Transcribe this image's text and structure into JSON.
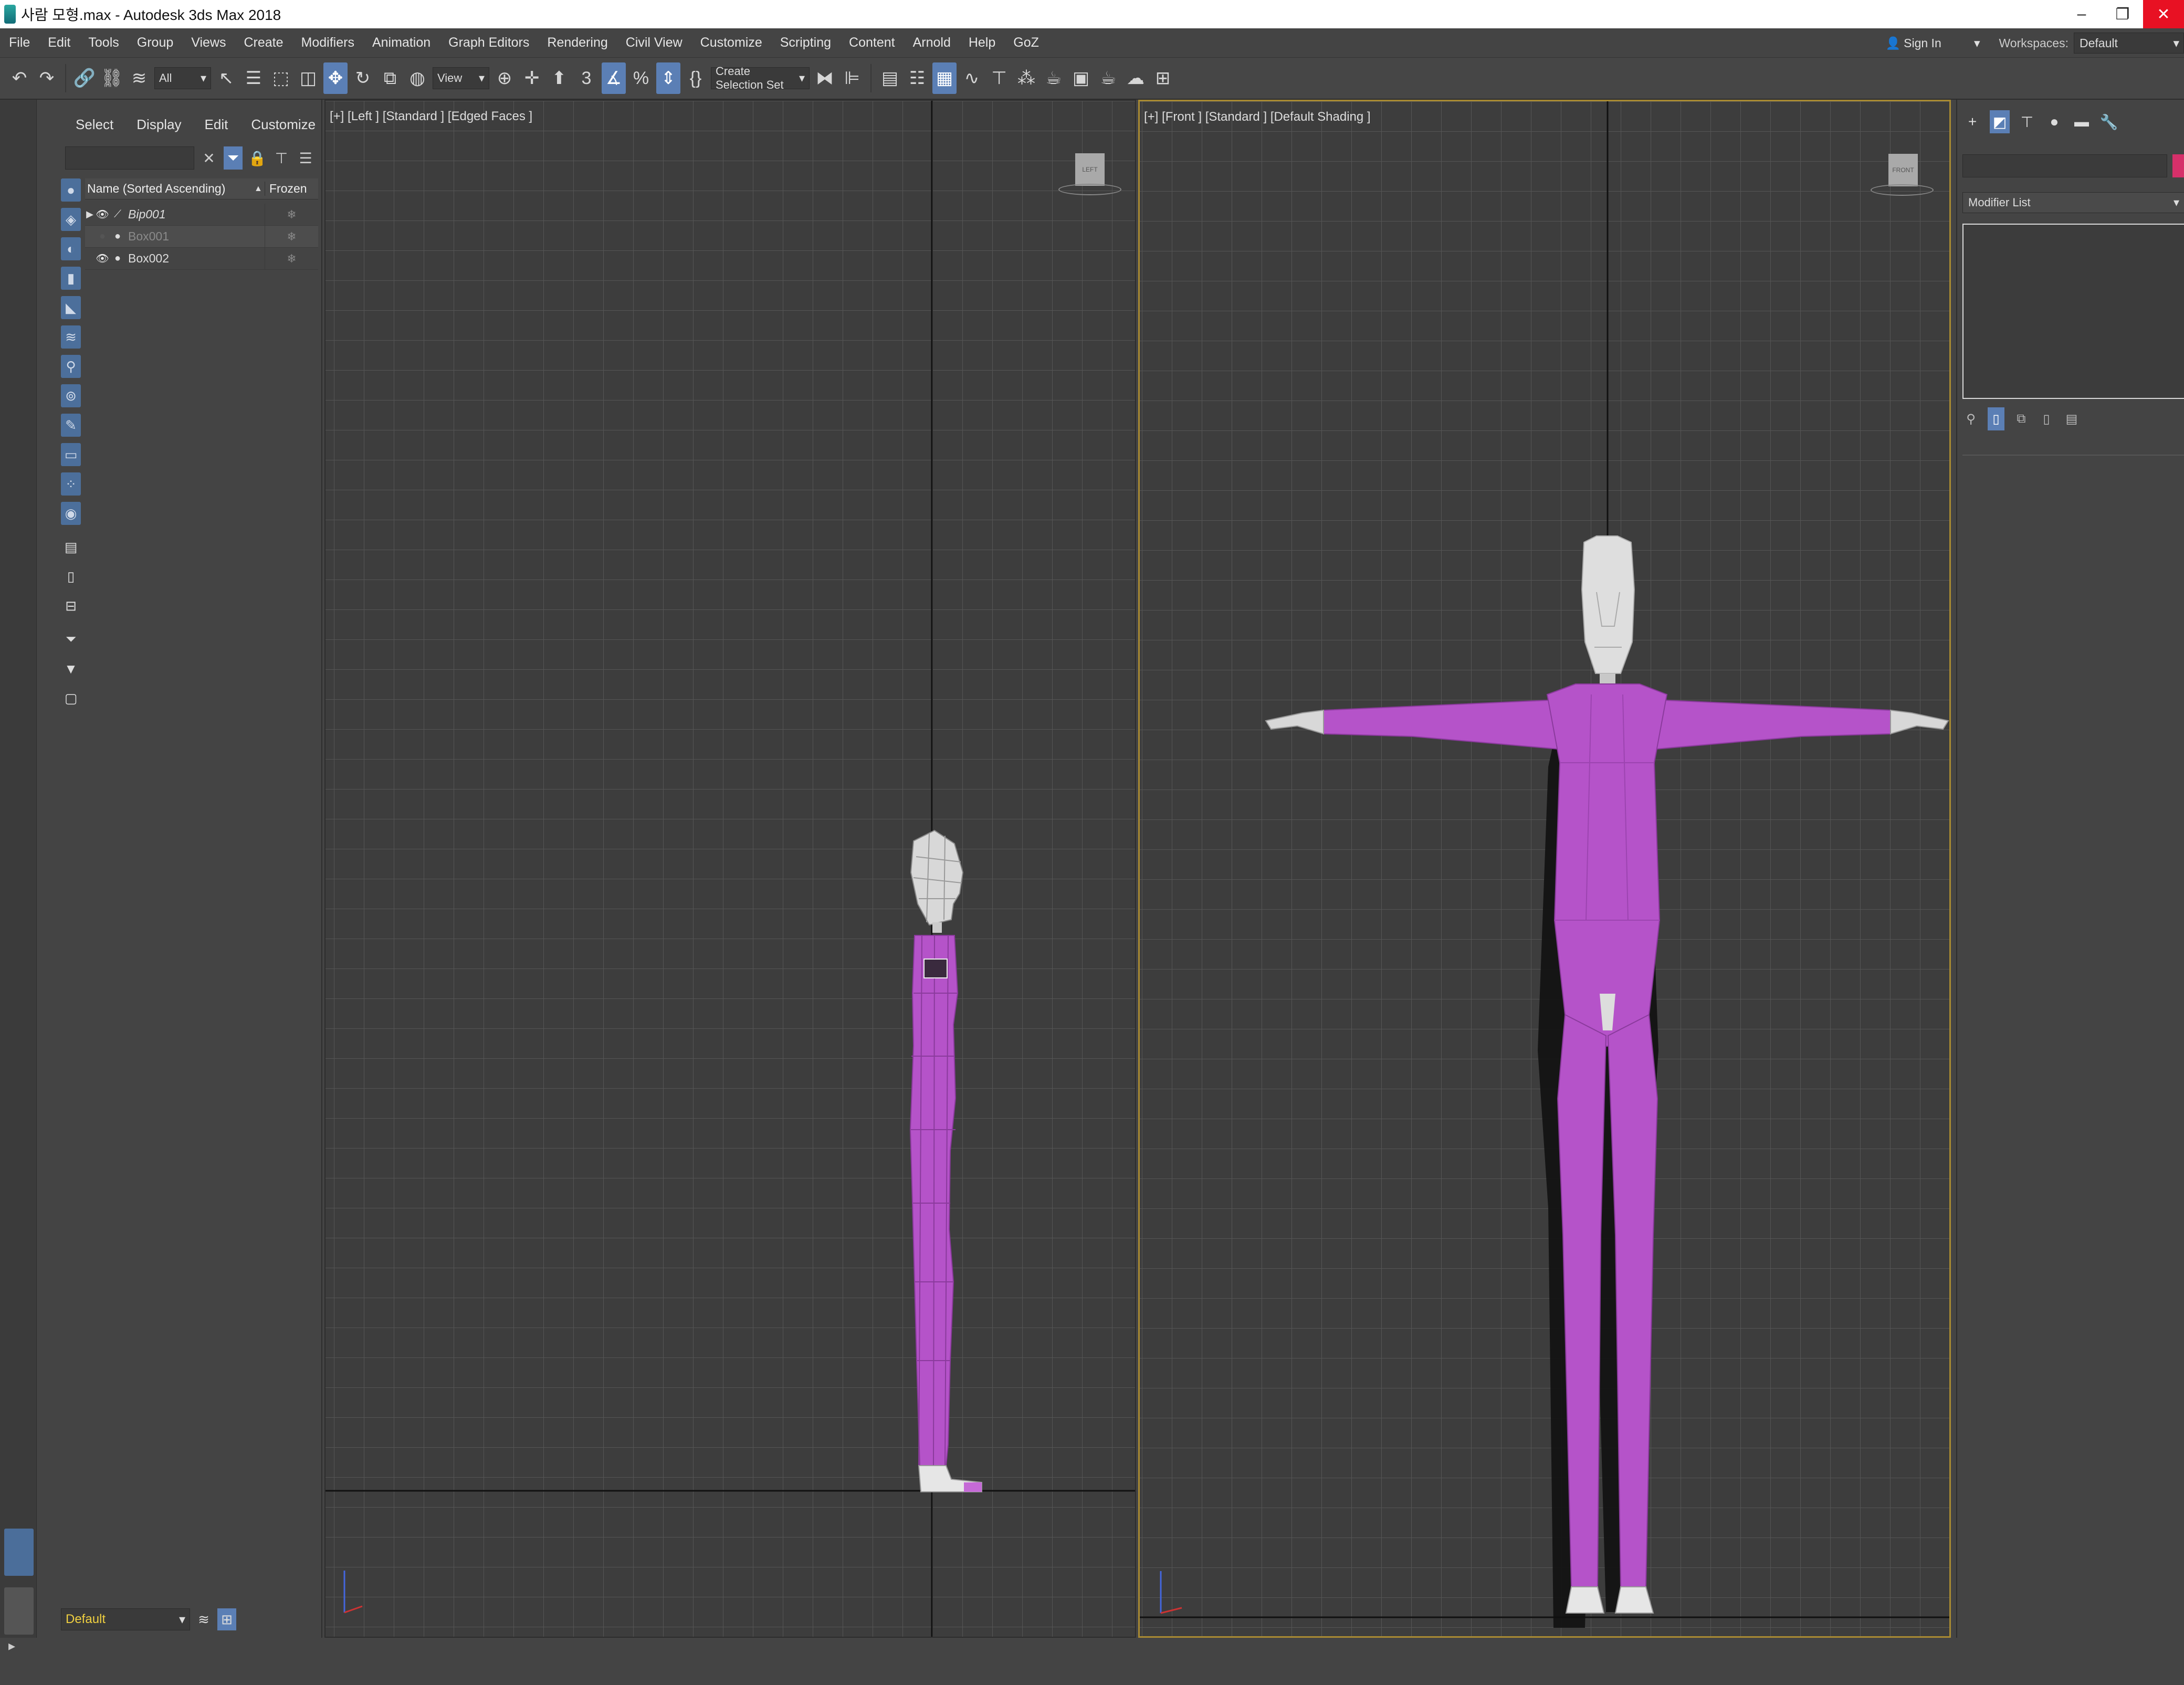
{
  "window": {
    "title": "사람 모형.max - Autodesk 3ds Max 2018",
    "minimize": "–",
    "restore": "❐",
    "close": "✕"
  },
  "menu": {
    "items": [
      "File",
      "Edit",
      "Tools",
      "Group",
      "Views",
      "Create",
      "Modifiers",
      "Animation",
      "Graph Editors",
      "Rendering",
      "Civil View",
      "Customize",
      "Scripting",
      "Content",
      "Arnold",
      "Help",
      "GoZ"
    ],
    "sign_in": "Sign In",
    "workspaces_label": "Workspaces:",
    "workspace_value": "Default"
  },
  "toolbar": {
    "selection_filter": "All",
    "ref_coord": "View",
    "named_selection": "Create Selection Set"
  },
  "explorer": {
    "tabs": [
      "Select",
      "Display",
      "Edit",
      "Customize"
    ],
    "col_name": "Name (Sorted Ascending)",
    "sort_indicator": "▲",
    "col_frozen": "Frozen",
    "rows": [
      {
        "name": "Bip001"
      },
      {
        "name": "Box001"
      },
      {
        "name": "Box002"
      }
    ],
    "layer": "Default"
  },
  "viewports": {
    "left": {
      "label": "[+] [Left ] [Standard ] [Edged Faces ]",
      "cube": "LEFT"
    },
    "front": {
      "label": "[+] [Front ] [Standard ] [Default Shading ]",
      "cube": "FRONT"
    }
  },
  "command_panel": {
    "modifier_list": "Modifier List"
  },
  "colors": {
    "accent": "#5b7fb5",
    "active_viewport_border": "#a88a32",
    "object_color": "#d6306a",
    "body_purple": "#b553c9",
    "close_red": "#e81123"
  }
}
